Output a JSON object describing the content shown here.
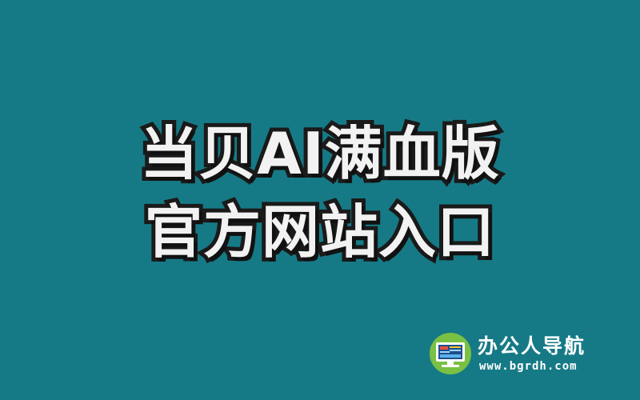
{
  "headline": {
    "line1": "当贝AI满血版",
    "line2": "官方网站入口"
  },
  "logo": {
    "title": "办公人导航",
    "url": "www.bgrdh.com",
    "icon": "monitor-logo-icon"
  },
  "colors": {
    "background": "#167a86",
    "headline_fill": "#f2f2f2",
    "headline_outline": "#1a1a1a",
    "logo_green": "#7ac143",
    "logo_text": "#ffffff"
  }
}
